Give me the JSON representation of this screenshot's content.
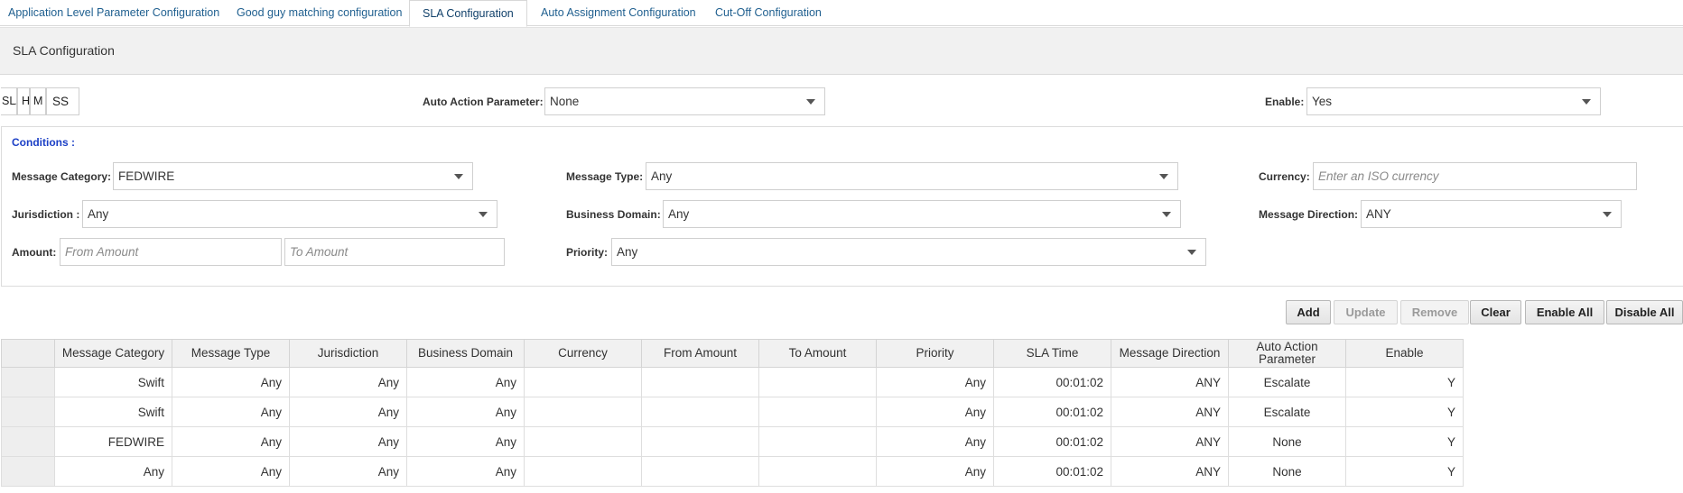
{
  "tabs": [
    {
      "label": "Application Level Parameter Configuration",
      "active": false
    },
    {
      "label": "Good guy matching configuration",
      "active": false
    },
    {
      "label": "SLA Configuration",
      "active": true
    },
    {
      "label": "Auto Assignment Configuration",
      "active": false
    },
    {
      "label": "Cut-Off Configuration",
      "active": false
    }
  ],
  "section": {
    "title": "SLA Configuration"
  },
  "sla": {
    "label": "SLA",
    "hours": "H",
    "minutes": "M",
    "seconds": "SS"
  },
  "auto_action": {
    "label": "Auto Action Parameter:",
    "value": "None"
  },
  "enable": {
    "label": "Enable:",
    "value": "Yes"
  },
  "conditions": {
    "title": "Conditions :",
    "message_category": {
      "label": "Message Category:",
      "value": "FEDWIRE"
    },
    "message_type": {
      "label": "Message Type:",
      "value": "Any"
    },
    "currency": {
      "label": "Currency:",
      "placeholder": "Enter an ISO currency"
    },
    "jurisdiction": {
      "label": "Jurisdiction :",
      "value": "Any"
    },
    "business_domain": {
      "label": "Business Domain:",
      "value": "Any"
    },
    "message_direction": {
      "label": "Message Direction:",
      "value": "ANY"
    },
    "amount": {
      "label": "Amount:",
      "from_placeholder": "From Amount",
      "to_placeholder": "To Amount"
    },
    "priority": {
      "label": "Priority:",
      "value": "Any"
    }
  },
  "buttons": {
    "add": "Add",
    "update": "Update",
    "remove": "Remove",
    "clear": "Clear",
    "enable_all": "Enable All",
    "disable_all": "Disable All"
  },
  "table": {
    "headers": [
      "Message Category",
      "Message Type",
      "Jurisdiction",
      "Business Domain",
      "Currency",
      "From Amount",
      "To Amount",
      "Priority",
      "SLA Time",
      "Message Direction",
      "Auto Action Parameter",
      "Enable"
    ],
    "rows": [
      [
        "Swift",
        "Any",
        "Any",
        "Any",
        "",
        "",
        "",
        "Any",
        "00:01:02",
        "ANY",
        "Escalate",
        "Y"
      ],
      [
        "Swift",
        "Any",
        "Any",
        "Any",
        "",
        "",
        "",
        "Any",
        "00:01:02",
        "ANY",
        "Escalate",
        "Y"
      ],
      [
        "FEDWIRE",
        "Any",
        "Any",
        "Any",
        "",
        "",
        "",
        "Any",
        "00:01:02",
        "ANY",
        "None",
        "Y"
      ],
      [
        "Any",
        "Any",
        "Any",
        "Any",
        "",
        "",
        "",
        "Any",
        "00:01:02",
        "ANY",
        "None",
        "Y"
      ]
    ]
  }
}
